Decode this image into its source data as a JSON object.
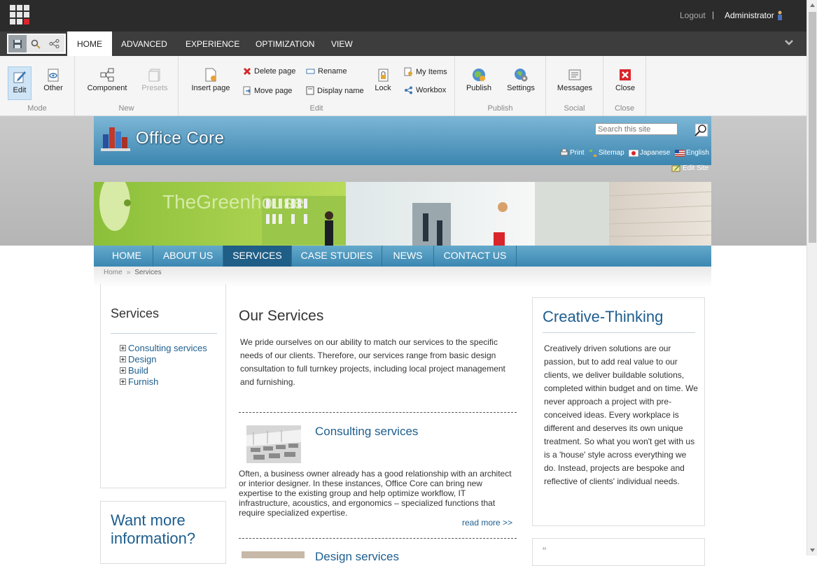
{
  "topbar": {
    "logout": "Logout",
    "separator": "|",
    "user": "Administrator"
  },
  "tabs": [
    "HOME",
    "ADVANCED",
    "EXPERIENCE",
    "OPTIMIZATION",
    "VIEW"
  ],
  "ribbon": {
    "mode": {
      "label": "Mode",
      "edit": "Edit",
      "other": "Other"
    },
    "new": {
      "label": "New",
      "component": "Component",
      "presets": "Presets"
    },
    "edit": {
      "label": "Edit",
      "insert_page": "Insert page",
      "delete_page": "Delete page",
      "move_page": "Move page",
      "rename": "Rename",
      "display_name": "Display name",
      "lock": "Lock",
      "my_items": "My Items",
      "workbox": "Workbox"
    },
    "publish": {
      "label": "Publish",
      "publish": "Publish",
      "settings": "Settings"
    },
    "social": {
      "label": "Social",
      "messages": "Messages"
    },
    "close": {
      "label": "Close",
      "close": "Close"
    }
  },
  "site": {
    "logo": "Office Core",
    "search_placeholder": "Search this site",
    "links": {
      "print": "Print",
      "sitemap": "Sitemap",
      "japanese": "Japanese",
      "english": "English"
    },
    "edit_site": "Edit Site",
    "banner_text": "TheGreenhouse",
    "nav": [
      "HOME",
      "ABOUT US",
      "SERVICES",
      "CASE STUDIES",
      "NEWS",
      "CONTACT US"
    ],
    "breadcrumb": {
      "home": "Home",
      "sep": "»",
      "current": "Services"
    }
  },
  "left": {
    "title": "Services",
    "items": [
      "Consulting services",
      "Design",
      "Build",
      "Furnish"
    ],
    "more_title": "Want more information?"
  },
  "main": {
    "title": "Our Services",
    "intro": "We pride ourselves on our ability to match our services to the specific needs of our clients. Therefore, our services range from basic design consultation to full turnkey projects, including local project management and furnishing.",
    "consult_title": "Consulting services",
    "consult_body": "Often, a business owner already has a good relationship with an architect or interior designer. In these instances, Office Core can bring new expertise to the existing group and help optimize workflow, IT infrastructure, acoustics, and ergonomics – specialized functions that require specialized expertise.",
    "read_more": "read more >>",
    "design_title": "Design services"
  },
  "right": {
    "title": "Creative-Thinking",
    "body": "Creatively driven solutions are our passion, but to add real value to our clients, we deliver buildable solutions, completed within budget and on time. We never approach a project with pre-conceived ideas. Every workplace is different and deserves its own unique treatment. So what you won't get with us is a 'house' style across everything we do. Instead, projects are bespoke and reflective of clients' individual needs.",
    "quote_mark": "“"
  },
  "colors": {
    "accent": "#1d5e8e",
    "topbar": "#2b2b2b",
    "nav": "#3b87b2",
    "nav_active": "#1f5e86"
  }
}
